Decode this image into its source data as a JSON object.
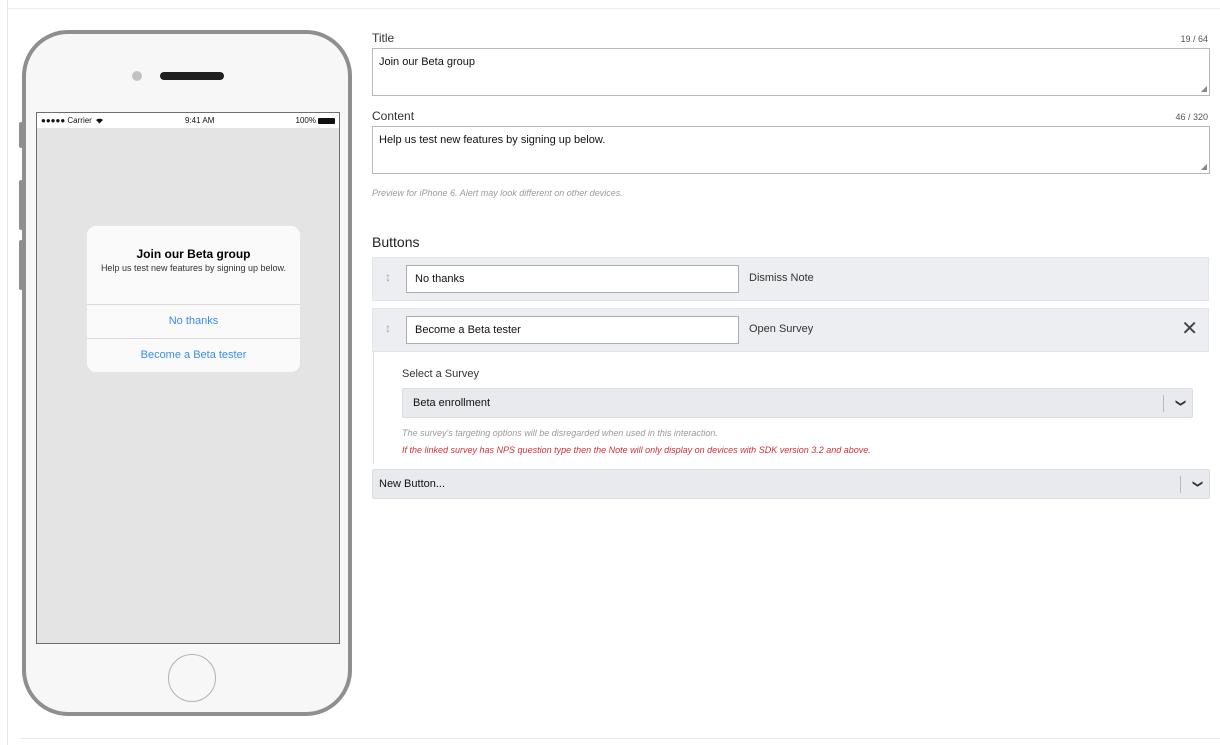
{
  "phone": {
    "status_bar": {
      "carrier": "●●●●● Carrier",
      "wifi_icon": "wifi-icon",
      "time": "9:41 AM",
      "battery_pct": "100%"
    },
    "alert": {
      "title": "Join our Beta group",
      "content": "Help us test new features by signing up below.",
      "buttons": [
        "No thanks",
        "Become a Beta tester"
      ],
      "button_color": "#3a8ee6"
    }
  },
  "form": {
    "title_label": "Title",
    "title_count": "19 / 64",
    "title_value": "Join our Beta group",
    "content_label": "Content",
    "content_count": "46 / 320",
    "content_value": "Help us test new features by signing up below.",
    "preview_hint": "Preview for iPhone 6. Alert may look different on other devices."
  },
  "buttons_section": {
    "heading": "Buttons",
    "rows": [
      {
        "label": "No thanks",
        "action": "Dismiss Note"
      },
      {
        "label": "Become a Beta tester",
        "action": "Open Survey",
        "remove_icon": "close-icon"
      }
    ],
    "survey": {
      "select_label": "Select a Survey",
      "selected": "Beta enrollment",
      "note": "The survey's targeting options will be disregarded when used in this interaction.",
      "warning": "If the linked survey has NPS question type then the Note will only display on devices with SDK version 3.2 and above.",
      "warning_color": "#d0313a"
    },
    "new_button": "New Button..."
  }
}
